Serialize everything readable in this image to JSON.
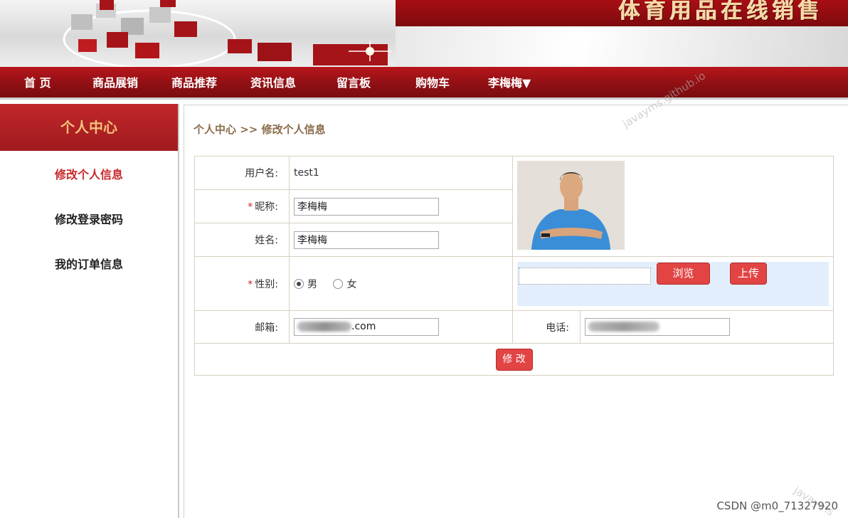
{
  "banner": {
    "site_title": "体育用品在线销售"
  },
  "nav": {
    "items": [
      "首 页",
      "商品展销",
      "商品推荐",
      "资讯信息",
      "留言板",
      "购物车",
      "李梅梅▼"
    ]
  },
  "sidebar": {
    "title": "个人中心",
    "links": [
      "修改个人信息",
      "修改登录密码",
      "我的订单信息"
    ]
  },
  "main": {
    "breadcrumb": "个人中心 >> 修改个人信息",
    "form": {
      "username_label": "用户名:",
      "username_value": "test1",
      "nickname_label": "昵称:",
      "nickname_value": "李梅梅",
      "realname_label": "姓名:",
      "realname_value": "李梅梅",
      "gender_label": "性别:",
      "gender_options": [
        "男",
        "女"
      ],
      "gender_selected": "男",
      "email_label": "邮箱:",
      "email_suffix": ".com",
      "phone_label": "电话:",
      "browse_label": "浏览",
      "upload_label": "上传",
      "submit_label": "修 改",
      "required_mark": "*"
    }
  },
  "watermarks": {
    "diag": "javayms.github.io",
    "corner": "javayms",
    "csdn": "CSDN @m0_71327920"
  },
  "colors": {
    "brand_red": "#a80f14",
    "button_red": "#e24444",
    "sidebar_active": "#c8282c"
  }
}
